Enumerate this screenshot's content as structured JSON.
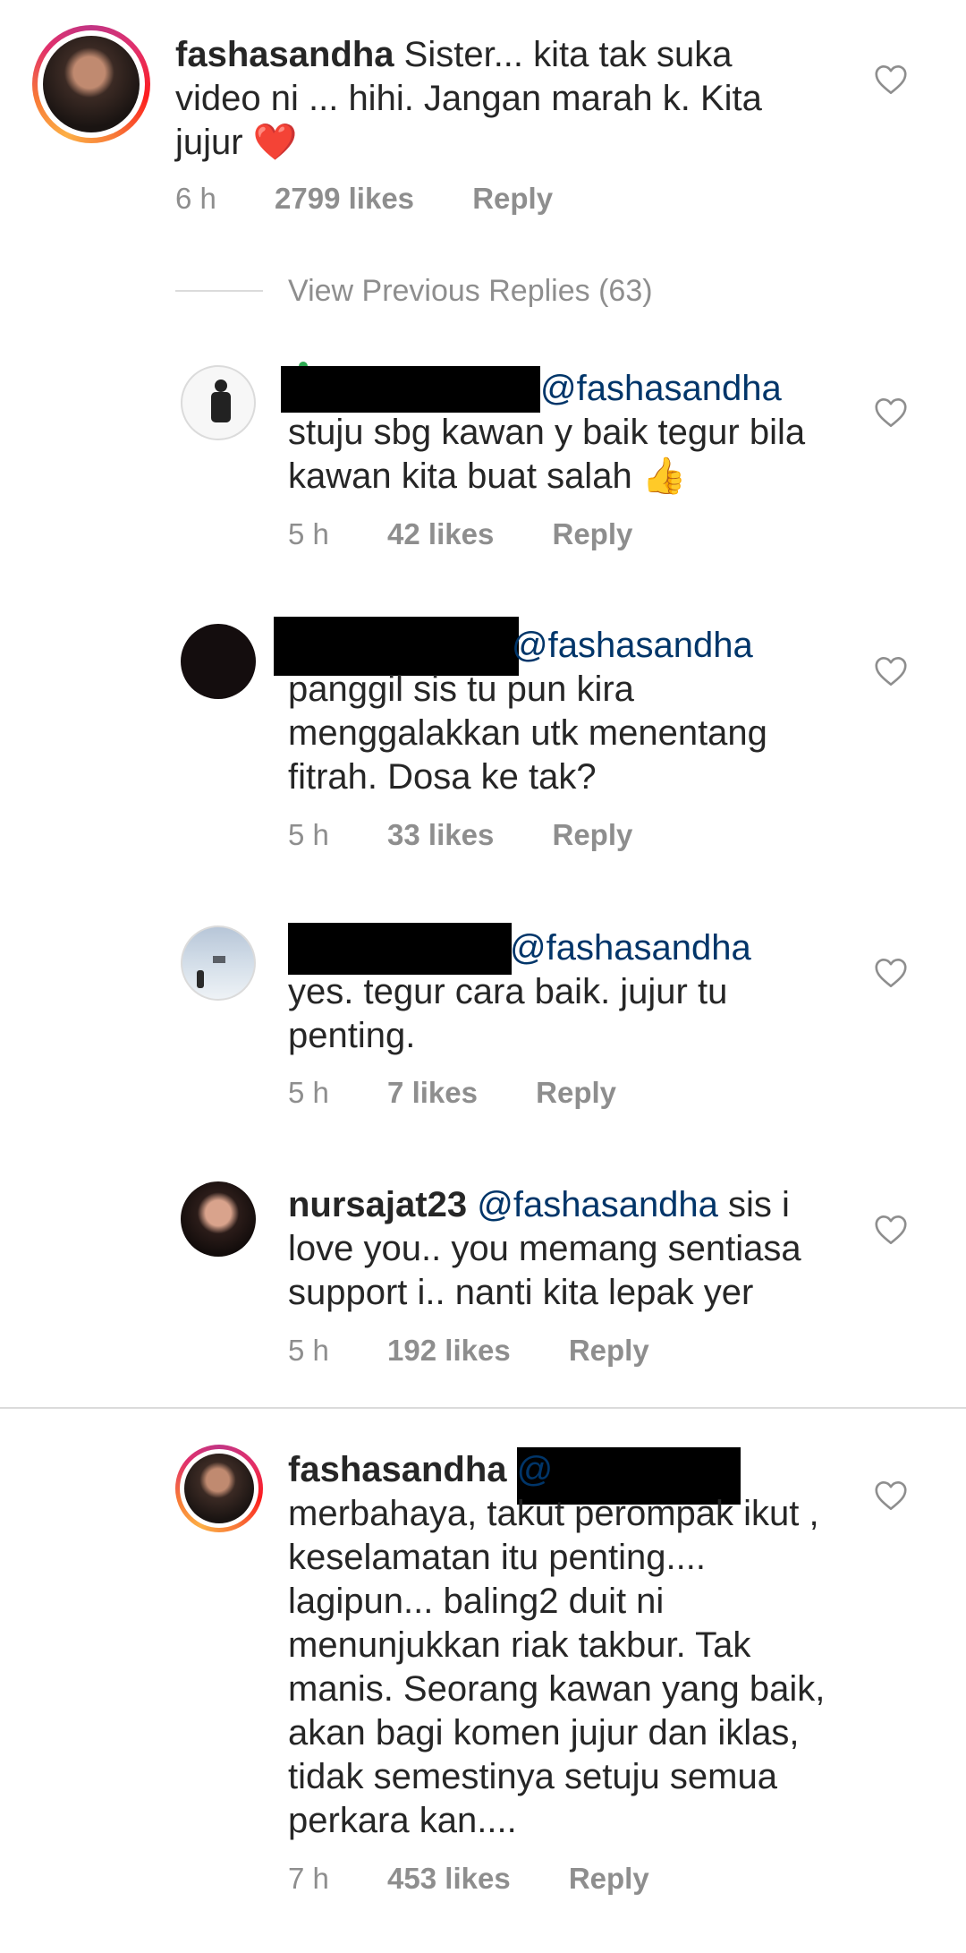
{
  "main_comment": {
    "username": "fashasandha",
    "text": "Sister... kita tak suka video ni ... hihi. Jangan marah k. Kita jujur",
    "emoji": "❤️",
    "time": "6 h",
    "likes": "2799 likes",
    "reply_label": "Reply"
  },
  "view_previous": "View Previous Replies (63)",
  "replies": [
    {
      "username": "",
      "mention": "@fashasandha",
      "text": "stuju sbg kawan y baik tegur bila kawan kita buat salah",
      "emoji": "👍",
      "time": "5 h",
      "likes": "42 likes",
      "reply_label": "Reply"
    },
    {
      "username": "",
      "mention": "@fashasandha",
      "text": "panggil sis tu pun kira menggalakkan utk menentang fitrah. Dosa ke tak?",
      "time": "5 h",
      "likes": "33 likes",
      "reply_label": "Reply"
    },
    {
      "username": "",
      "mention": "@fashasandha",
      "text": "yes. tegur cara baik. jujur tu penting.",
      "time": "5 h",
      "likes": "7 likes",
      "reply_label": "Reply"
    },
    {
      "username": "nursajat23",
      "mention": "@fashasandha",
      "text": "sis i love you.. you memang sentiasa support i.. nanti kita lepak yer",
      "time": "5 h",
      "likes": "192 likes",
      "reply_label": "Reply"
    }
  ],
  "second_comment": {
    "username": "fashasandha",
    "mention": "@",
    "text": "merbahaya, takut perompak ikut , keselamatan itu penting.... lagipun... baling2 duit ni menunjukkan riak takbur. Tak manis. Seorang kawan yang baik, akan bagi komen jujur dan iklas, tidak semestinya setuju semua perkara kan....",
    "time": "7 h",
    "likes": "453 likes",
    "reply_label": "Reply"
  },
  "colors": {
    "mention": "#003569",
    "meta": "#8e8e8e",
    "divider": "#dbdbdb",
    "text": "#262626"
  },
  "icons": {
    "like": "heart-outline-icon"
  }
}
